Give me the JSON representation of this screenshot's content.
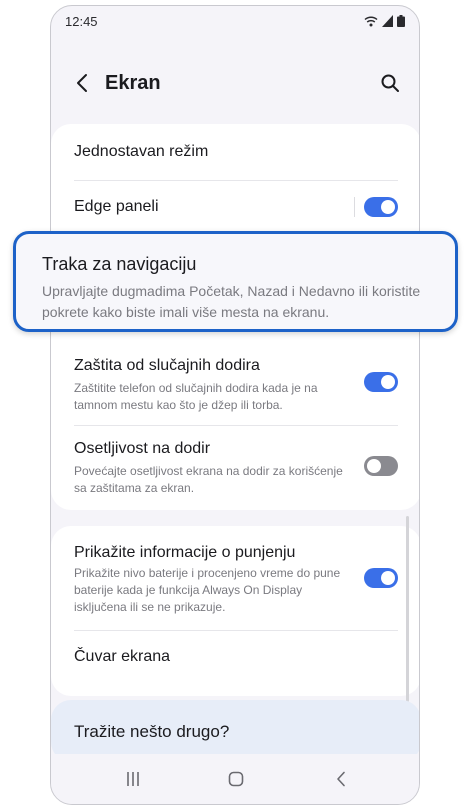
{
  "status_bar": {
    "time": "12:45"
  },
  "header": {
    "title": "Ekran"
  },
  "settings": {
    "simple_mode": {
      "title": "Jednostavan režim"
    },
    "edge_panels": {
      "title": "Edge paneli",
      "enabled": true
    },
    "navigation_bar": {
      "title": "Traka za navigaciju",
      "subtitle": "Upravljajte dugmadima Početak, Nazad i Nedavno ili koristite pokrete kako biste imali više mesta na ekranu."
    },
    "accidental_touch": {
      "title": "Zaštita od slučajnih dodira",
      "subtitle": "Zaštitite telefon od slučajnih dodira kada je na tamnom mestu kao što je džep ili torba.",
      "enabled": true
    },
    "touch_sensitivity": {
      "title": "Osetljivost na dodir",
      "subtitle": "Povećajte osetljivost ekrana na dodir za korišćenje sa zaštitama za ekran.",
      "enabled": false
    },
    "charging_info": {
      "title": "Prikažite informacije o punjenju",
      "subtitle": "Prikažite nivo baterije i procenjeno vreme do pune baterije kada je funkcija Always On Display isključena ili se ne prikazuje.",
      "enabled": true
    },
    "screen_saver": {
      "title": "Čuvar ekrana"
    }
  },
  "search_prompt": {
    "label": "Tražite nešto drugo?"
  },
  "icons": {
    "back": "chevron-left-icon",
    "search": "search-icon",
    "recents": "recents-icon",
    "home": "home-icon",
    "nav_back": "nav-back-icon"
  },
  "colors": {
    "accent": "#3a6fe8",
    "highlight_border": "#1d62c8",
    "background": "#f5f4f9"
  }
}
